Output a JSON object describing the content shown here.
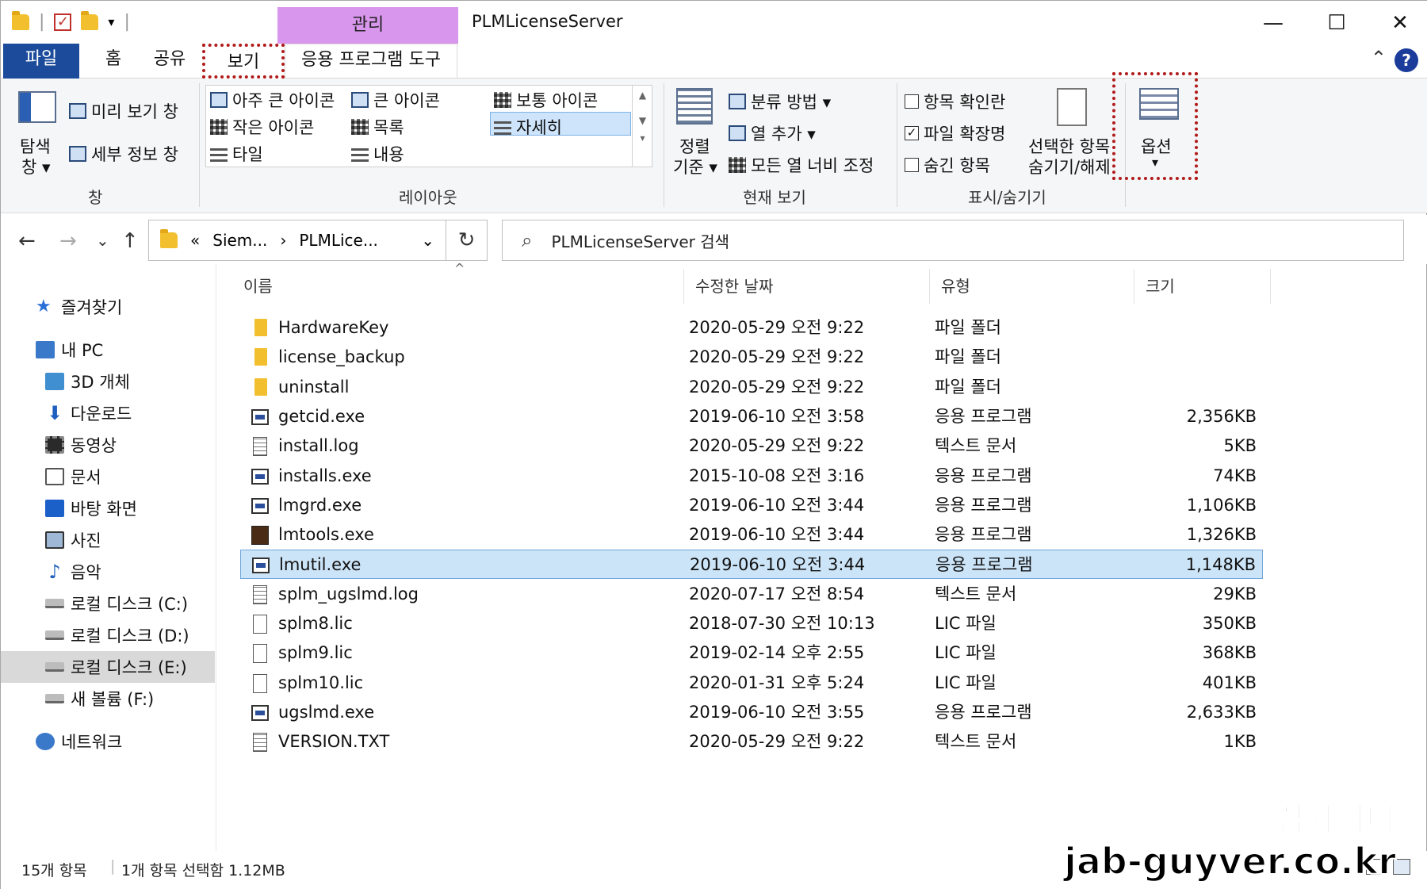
{
  "window": {
    "title": "PLMLicenseServer",
    "context_tab": "관리",
    "minimize": "—",
    "maximize": "☐",
    "close": "✕"
  },
  "tabs": {
    "file": "파일",
    "home": "홈",
    "share": "공유",
    "view": "보기",
    "app_tools": "응용 프로그램 도구",
    "help": "?"
  },
  "ribbon": {
    "pane": {
      "nav_pane_line1": "탐색",
      "nav_pane_line2": "창 ▾",
      "preview": "미리 보기 창",
      "details": "세부 정보 창",
      "group": "창"
    },
    "layout": {
      "xl_icons": "아주 큰 아이콘",
      "large_icons": "큰 아이콘",
      "medium_icons": "보통 아이콘",
      "small_icons": "작은 아이콘",
      "list": "목록",
      "details": "자세히",
      "tiles": "타일",
      "content": "내용",
      "group": "레이아웃"
    },
    "current_view": {
      "sort_line1": "정렬",
      "sort_line2": "기준 ▾",
      "group_by": "분류 방법 ▾",
      "add_columns": "열 추가 ▾",
      "size_all": "모든 열 너비 조정",
      "group": "현재 보기"
    },
    "show_hide": {
      "item_checkboxes": "항목 확인란",
      "file_extensions": "파일 확장명",
      "hidden_items": "숨긴 항목",
      "hide_selected_line1": "선택한 항목",
      "hide_selected_line2": "숨기기/해제",
      "group": "표시/숨기기",
      "item_checkboxes_checked": false,
      "file_extensions_checked": true,
      "hidden_items_checked": false
    },
    "options": {
      "label": "옵션",
      "arrow": "▾"
    }
  },
  "address": {
    "back": "←",
    "forward": "→",
    "recent": "⌄",
    "up": "↑",
    "overflow": "«",
    "crumb1": "Siem...",
    "sep": "›",
    "crumb2": "PLMLice...",
    "dropdown": "⌄",
    "refresh": "↻",
    "search_placeholder": "PLMLicenseServer 검색",
    "search_icon": "⌕"
  },
  "nav": {
    "quick_access": "즐겨찾기",
    "this_pc": "내 PC",
    "objects3d": "3D 개체",
    "downloads": "다운로드",
    "videos": "동영상",
    "documents": "문서",
    "desktop": "바탕 화면",
    "pictures": "사진",
    "music": "음악",
    "disk_c": "로컬 디스크 (C:)",
    "disk_d": "로컬 디스크 (D:)",
    "disk_e": "로컬 디스크 (E:)",
    "vol_f": "새 볼륨 (F:)",
    "network": "네트워크"
  },
  "columns": {
    "name": "이름",
    "date": "수정한 날짜",
    "type": "유형",
    "size": "크기",
    "sort_arrow": "^"
  },
  "files": [
    {
      "name": "HardwareKey",
      "date": "2020-05-29 오전 9:22",
      "type": "파일 폴더",
      "size": "",
      "icon": "folder"
    },
    {
      "name": "license_backup",
      "date": "2020-05-29 오전 9:22",
      "type": "파일 폴더",
      "size": "",
      "icon": "folder"
    },
    {
      "name": "uninstall",
      "date": "2020-05-29 오전 9:22",
      "type": "파일 폴더",
      "size": "",
      "icon": "folder"
    },
    {
      "name": "getcid.exe",
      "date": "2019-06-10 오전 3:58",
      "type": "응용 프로그램",
      "size": "2,356KB",
      "icon": "exe"
    },
    {
      "name": "install.log",
      "date": "2020-05-29 오전 9:22",
      "type": "텍스트 문서",
      "size": "5KB",
      "icon": "lines"
    },
    {
      "name": "installs.exe",
      "date": "2015-10-08 오전 3:16",
      "type": "응용 프로그램",
      "size": "74KB",
      "icon": "exe"
    },
    {
      "name": "lmgrd.exe",
      "date": "2019-06-10 오전 3:44",
      "type": "응용 프로그램",
      "size": "1,106KB",
      "icon": "exe"
    },
    {
      "name": "lmtools.exe",
      "date": "2019-06-10 오전 3:44",
      "type": "응용 프로그램",
      "size": "1,326KB",
      "icon": "tool"
    },
    {
      "name": "lmutil.exe",
      "date": "2019-06-10 오전 3:44",
      "type": "응용 프로그램",
      "size": "1,148KB",
      "icon": "exe",
      "selected": true
    },
    {
      "name": "splm_ugslmd.log",
      "date": "2020-07-17 오전 8:54",
      "type": "텍스트 문서",
      "size": "29KB",
      "icon": "lines"
    },
    {
      "name": "splm8.lic",
      "date": "2018-07-30 오전 10:13",
      "type": "LIC 파일",
      "size": "350KB",
      "icon": "doc"
    },
    {
      "name": "splm9.lic",
      "date": "2019-02-14 오후 2:55",
      "type": "LIC 파일",
      "size": "368KB",
      "icon": "doc"
    },
    {
      "name": "splm10.lic",
      "date": "2020-01-31 오후 5:24",
      "type": "LIC 파일",
      "size": "401KB",
      "icon": "doc"
    },
    {
      "name": "ugslmd.exe",
      "date": "2019-06-10 오전 3:55",
      "type": "응용 프로그램",
      "size": "2,633KB",
      "icon": "exe"
    },
    {
      "name": "VERSION.TXT",
      "date": "2020-05-29 오전 9:22",
      "type": "텍스트 문서",
      "size": "1KB",
      "icon": "lines"
    }
  ],
  "status": {
    "count": "15개 항목",
    "selected": "1개 항목 선택함 1.12MB"
  },
  "watermark": {
    "line1": "잡가이버",
    "line2": "jab-guyver.co.kr"
  },
  "colors": {
    "file_tab": "#1b4b9a",
    "manage_tab": "#d896ec",
    "selection": "#cce4f7",
    "highlight_box": "#b11b1b"
  }
}
